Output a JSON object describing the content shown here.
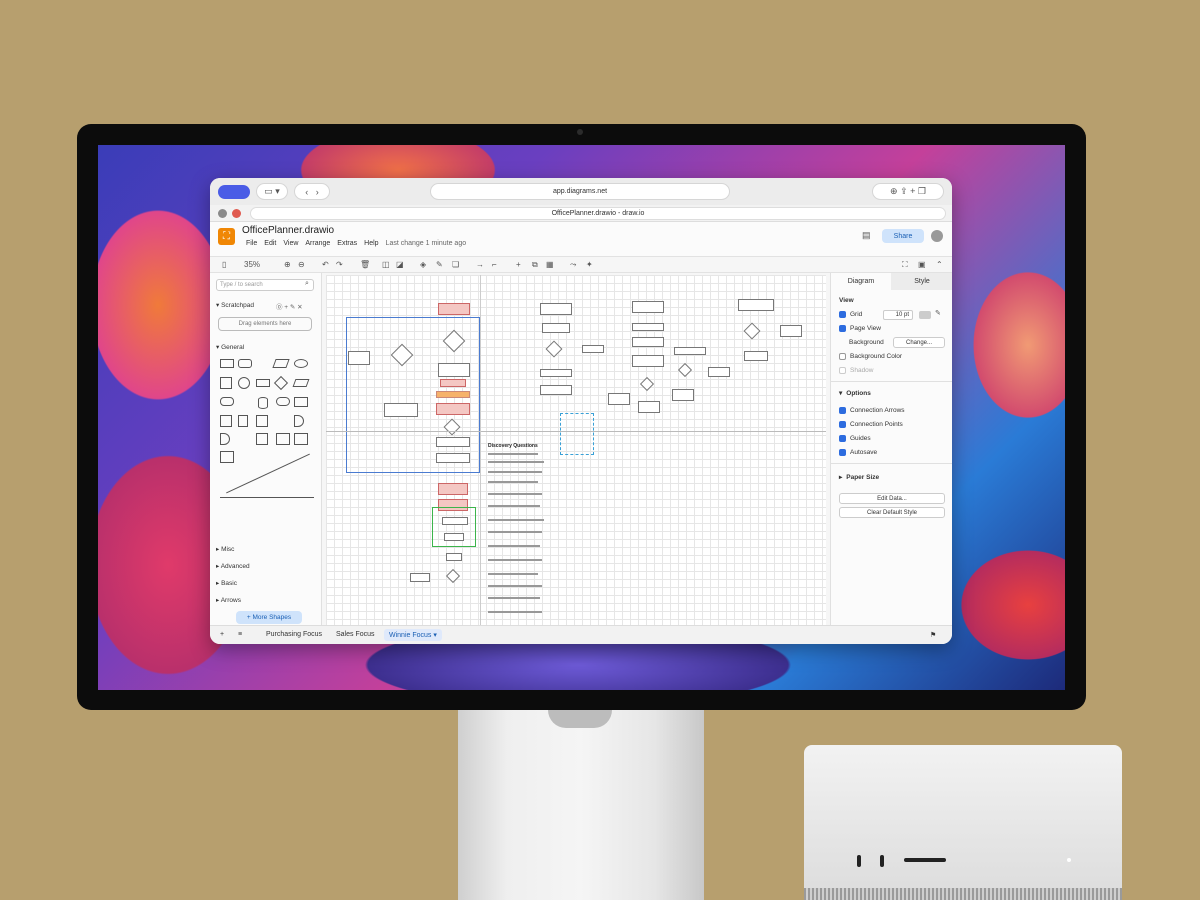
{
  "browser": {
    "url": "app.diagrams.net",
    "tab_title": "OfficePlanner.drawio - draw.io"
  },
  "app": {
    "file_name": "OfficePlanner.drawio",
    "menus": [
      "File",
      "Edit",
      "View",
      "Arrange",
      "Extras",
      "Help"
    ],
    "last_change": "Last change 1 minute ago",
    "share_label": "Share",
    "zoom": "35%"
  },
  "left_panel": {
    "search_placeholder": "Type / to search",
    "scratchpad": "Scratchpad",
    "drag_hint": "Drag elements here",
    "general": "General",
    "sections": [
      "Misc",
      "Advanced",
      "Basic",
      "Arrows"
    ],
    "more_shapes": "+ More Shapes"
  },
  "canvas": {
    "doc_heading": "Discovery Questions"
  },
  "right_panel": {
    "tabs": [
      "Diagram",
      "Style"
    ],
    "view_heading": "View",
    "grid_label": "Grid",
    "grid_size": "10 pt",
    "page_view_label": "Page View",
    "background_label": "Background",
    "change_button": "Change...",
    "background_color_label": "Background Color",
    "shadow_label": "Shadow",
    "options_heading": "Options",
    "connection_arrows": "Connection Arrows",
    "connection_points": "Connection Points",
    "guides": "Guides",
    "autosave": "Autosave",
    "paper_size_heading": "Paper Size",
    "edit_data_button": "Edit Data...",
    "clear_style_button": "Clear Default Style"
  },
  "pages": {
    "tabs": [
      "Purchasing Focus",
      "Sales Focus",
      "Winnie Focus"
    ],
    "active_index": 2
  },
  "colors": {
    "accent": "#2d6cdf",
    "logo": "#f08705",
    "share_bg": "#cfe3fb"
  }
}
